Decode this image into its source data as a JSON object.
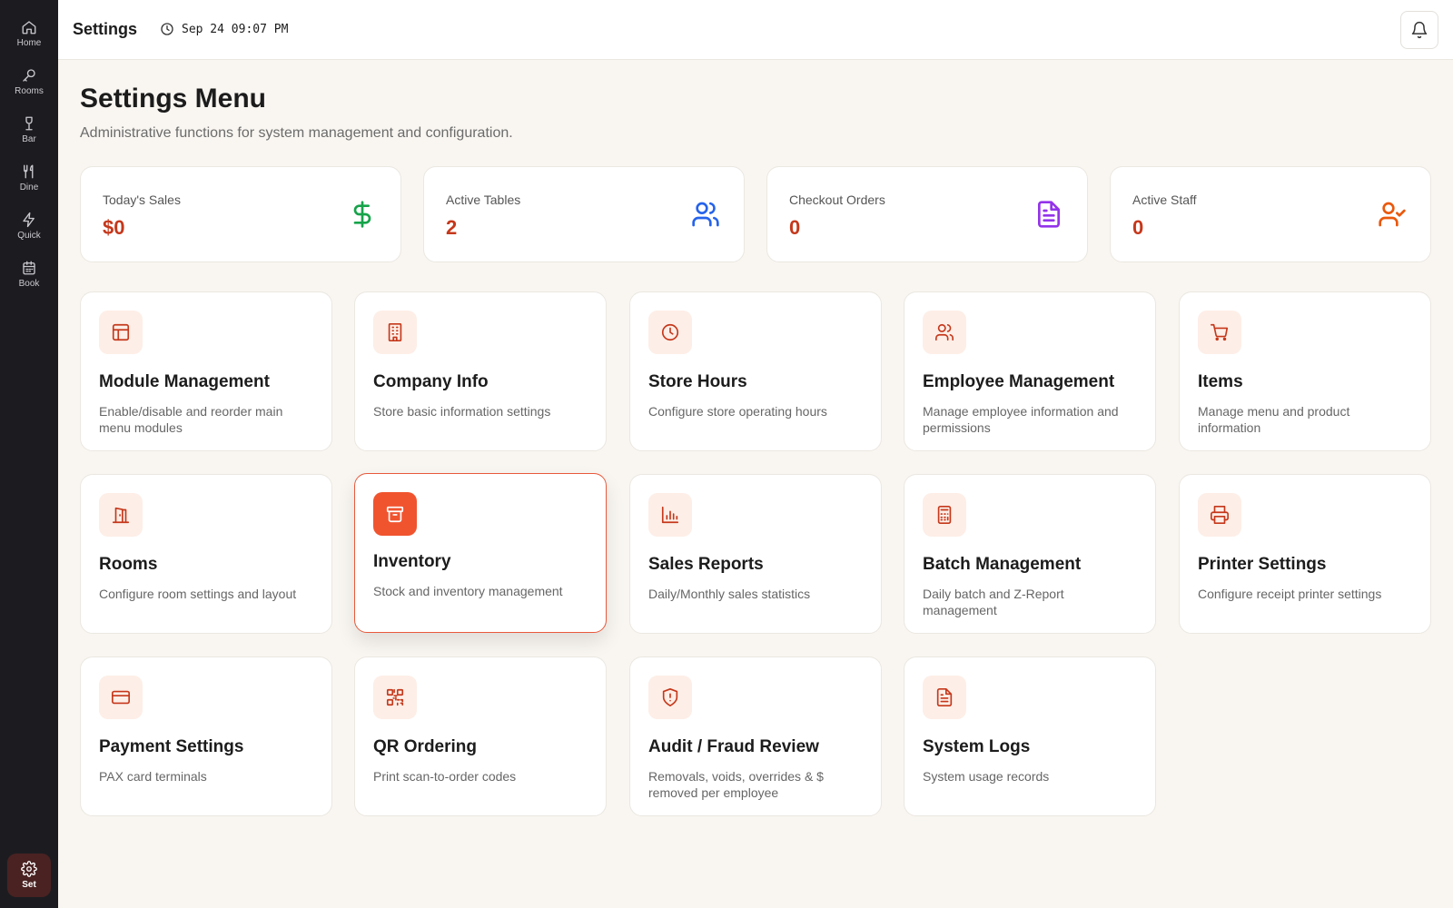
{
  "sidebar": {
    "items": [
      {
        "label": "Home"
      },
      {
        "label": "Rooms"
      },
      {
        "label": "Bar"
      },
      {
        "label": "Dine"
      },
      {
        "label": "Quick"
      },
      {
        "label": "Book"
      }
    ],
    "settings": {
      "label": "Set"
    }
  },
  "topbar": {
    "title": "Settings",
    "datetime": "Sep 24 09:07 PM"
  },
  "header": {
    "title": "Settings Menu",
    "subtitle": "Administrative functions for system management and configuration."
  },
  "stats": [
    {
      "label": "Today's Sales",
      "value": "$0",
      "icon": "dollar-icon",
      "color": "#16a34a"
    },
    {
      "label": "Active Tables",
      "value": "2",
      "icon": "users-icon",
      "color": "#2563eb"
    },
    {
      "label": "Checkout Orders",
      "value": "0",
      "icon": "file-text-icon",
      "color": "#9333ea"
    },
    {
      "label": "Active Staff",
      "value": "0",
      "icon": "user-check-icon",
      "color": "#ea580c"
    }
  ],
  "menu": [
    {
      "title": "Module Management",
      "desc": "Enable/disable and reorder main menu modules",
      "icon": "layout-icon"
    },
    {
      "title": "Company Info",
      "desc": "Store basic information settings",
      "icon": "building-icon"
    },
    {
      "title": "Store Hours",
      "desc": "Configure store operating hours",
      "icon": "clock-icon"
    },
    {
      "title": "Employee Management",
      "desc": "Manage employee information and permissions",
      "icon": "users-icon"
    },
    {
      "title": "Items",
      "desc": "Manage menu and product information",
      "icon": "cart-icon"
    },
    {
      "title": "Rooms",
      "desc": "Configure room settings and layout",
      "icon": "door-icon"
    },
    {
      "title": "Inventory",
      "desc": "Stock and inventory management",
      "icon": "archive-icon"
    },
    {
      "title": "Sales Reports",
      "desc": "Daily/Monthly sales statistics",
      "icon": "bar-chart-icon"
    },
    {
      "title": "Batch Management",
      "desc": "Daily batch and Z-Report management",
      "icon": "calculator-icon"
    },
    {
      "title": "Printer Settings",
      "desc": "Configure receipt printer settings",
      "icon": "printer-icon"
    },
    {
      "title": "Payment Settings",
      "desc": "PAX card terminals",
      "icon": "credit-card-icon"
    },
    {
      "title": "QR Ordering",
      "desc": "Print scan-to-order codes",
      "icon": "qr-code-icon"
    },
    {
      "title": "Audit / Fraud Review",
      "desc": "Removals, voids, overrides & $ removed per employee",
      "icon": "shield-alert-icon"
    },
    {
      "title": "System Logs",
      "desc": "System usage records",
      "icon": "file-text-icon"
    }
  ],
  "colors": {
    "accent": "#c5381b",
    "accent_active": "#f0542f",
    "sidebar_bg": "#1c1c20",
    "page_bg": "#f9f6f1"
  }
}
